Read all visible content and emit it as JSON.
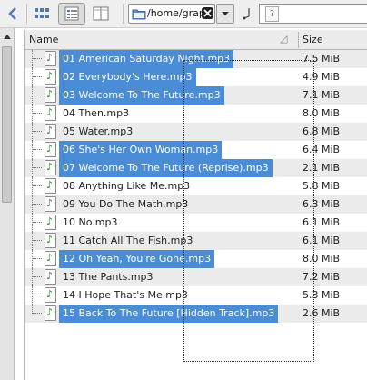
{
  "toolbar": {
    "location_path": "/home/grap",
    "search_placeholder": "?"
  },
  "columns": {
    "name": "Name",
    "size": "Size"
  },
  "files": [
    {
      "name": "01 American Saturday Night.mp3",
      "size": "7.5 MiB",
      "selected": true
    },
    {
      "name": "02 Everybody's Here.mp3",
      "size": "4.9 MiB",
      "selected": true
    },
    {
      "name": "03 Welcome To The Future.mp3",
      "size": "7.1 MiB",
      "selected": true
    },
    {
      "name": "04 Then.mp3",
      "size": "8.0 MiB",
      "selected": false
    },
    {
      "name": "05 Water.mp3",
      "size": "6.8 MiB",
      "selected": false
    },
    {
      "name": "06 She's Her Own Woman.mp3",
      "size": "6.4 MiB",
      "selected": true
    },
    {
      "name": "07 Welcome To The Future (Reprise).mp3",
      "size": "2.1 MiB",
      "selected": true
    },
    {
      "name": "08 Anything Like Me.mp3",
      "size": "5.8 MiB",
      "selected": false
    },
    {
      "name": "09 You Do The Math.mp3",
      "size": "6.3 MiB",
      "selected": false
    },
    {
      "name": "10 No.mp3",
      "size": "6.1 MiB",
      "selected": false
    },
    {
      "name": "11 Catch All The Fish.mp3",
      "size": "6.1 MiB",
      "selected": false
    },
    {
      "name": "12 Oh Yeah, You're Gone.mp3",
      "size": "8.0 MiB",
      "selected": true
    },
    {
      "name": "13 The Pants.mp3",
      "size": "7.2 MiB",
      "selected": false
    },
    {
      "name": "14 I Hope That's Me.mp3",
      "size": "5.3 MiB",
      "selected": false
    },
    {
      "name": "15 Back To The Future [Hidden Track].mp3",
      "size": "2.6 MiB",
      "selected": true
    }
  ],
  "colors": {
    "selection": "#4a8cd6",
    "row_alt": "#ebebeb"
  }
}
